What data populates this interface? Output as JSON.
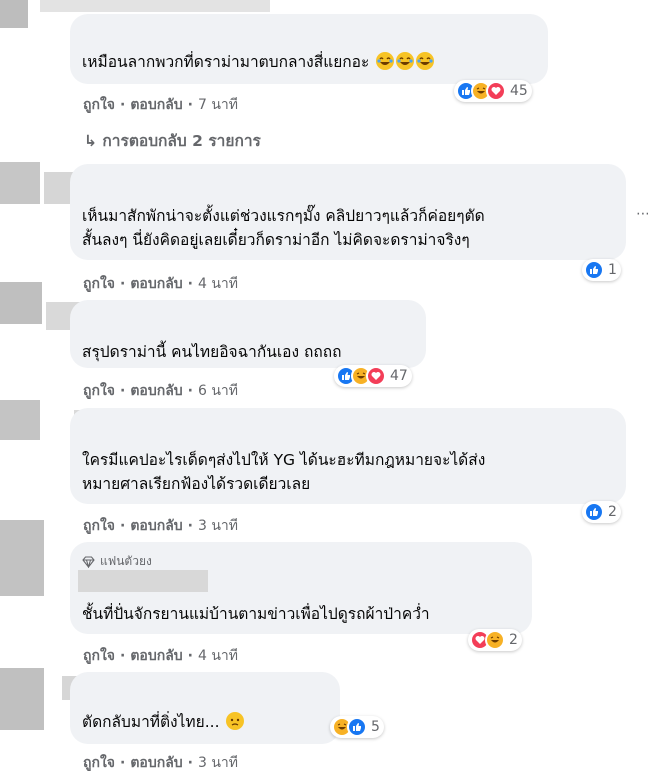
{
  "actions": {
    "like": "ถูกใจ",
    "reply": "ตอบกลับ",
    "separator": "·"
  },
  "colors": {
    "bubble": "#f0f2f5",
    "meta": "#65676b",
    "like": "#1877f2",
    "haha": "#f7b125",
    "love": "#f33e58"
  },
  "comments": [
    {
      "lines": [
        "เหมือนลากพวกที่ดราม่ามาตบกลางสี่แยกอะ"
      ],
      "trailing_emoji": [
        "laughing-crying-emoji",
        "laughing-crying-emoji",
        "laughing-crying-emoji"
      ],
      "time": "7 นาที",
      "reactions": [
        "like",
        "haha",
        "love"
      ],
      "reaction_count": "45",
      "view_replies": "การตอบกลับ 2 รายการ"
    },
    {
      "lines": [
        "เห็นมาสักพักน่าจะตั้งแต่ช่วงแรกๆมั๊ง คลิปยาวๆแล้วก็ค่อยๆตัด",
        "สั้นลงๆ นี่ยังคิดอยู่เลยเดี๋ยวก็ดราม่าอีก ไม่คิดจะดราม่าจริงๆ"
      ],
      "time": "4 นาที",
      "reactions": [
        "like"
      ],
      "reaction_count": "1"
    },
    {
      "lines": [
        "สรุปดราม่านี้ คนไทยอิจฉากันเอง ถถถถ"
      ],
      "time": "6 นาที",
      "reactions": [
        "like",
        "haha",
        "love"
      ],
      "reaction_count": "47"
    },
    {
      "lines": [
        "ใครมีแคปอะไรเด็ดๆส่งไปให้ YG ได้นะฮะทีมกฎหมายจะได้ส่ง",
        "หมายศาลเรียกฟ้องได้รวดเดียวเลย"
      ],
      "time": "3 นาที",
      "reactions": [
        "like"
      ],
      "reaction_count": "2"
    },
    {
      "badge": "แฟนตัวยง",
      "lines": [
        "ชั้นที่ปั่นจักรยานแม่บ้านตามข่าวเพื่อไปดูรถผ้าป่าคว่ำ"
      ],
      "time": "4 นาที",
      "reactions": [
        "love",
        "haha"
      ],
      "reaction_count": "2"
    },
    {
      "lines": [
        "ตัดกลับมาที่ติ่งไทย..."
      ],
      "trailing_emoji": [
        "sad-face-emoji"
      ],
      "time": "3 นาที",
      "reactions": [
        "haha",
        "like"
      ],
      "reaction_count": "5"
    }
  ]
}
